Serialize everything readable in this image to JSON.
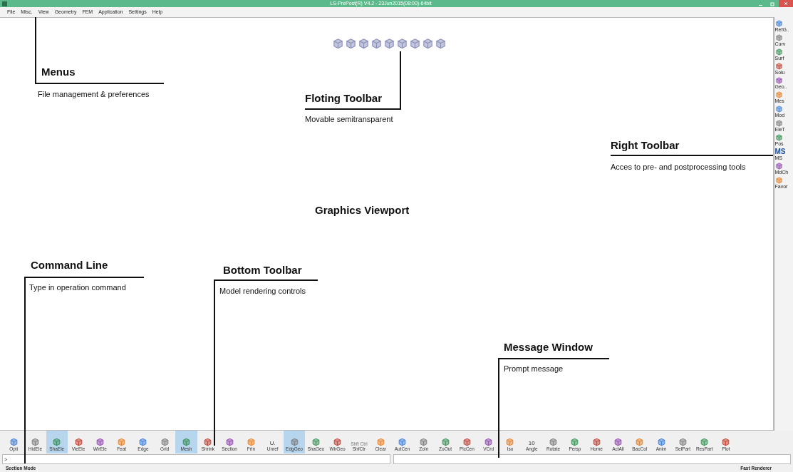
{
  "window": {
    "title": "LS-PrePost(R) V4.2 - 23Jun2015(08:00)-64bit"
  },
  "menu": [
    "File",
    "Misc.",
    "View",
    "Geometry",
    "FEM",
    "Application",
    "Settings",
    "Help"
  ],
  "annotations": [
    {
      "heading": "Menus",
      "text": "File management & preferences"
    },
    {
      "heading": "Floting Toolbar",
      "text": "Movable semitransparent"
    },
    {
      "heading": "Right Toolbar",
      "text": "Acces to pre- and postprocessing tools"
    },
    {
      "heading": "Graphics Viewport"
    },
    {
      "heading": "Command Line",
      "text": "Type in operation command"
    },
    {
      "heading": "Bottom Toolbar",
      "text": "Model rendering controls"
    },
    {
      "heading": "Message Window",
      "text": "Prompt message"
    }
  ],
  "right_toolbar": [
    {
      "label": "RefG.."
    },
    {
      "label": "Curv"
    },
    {
      "label": "Surf"
    },
    {
      "label": "Solu"
    },
    {
      "label": "Geo.."
    },
    {
      "label": "Mes"
    },
    {
      "label": "Mod"
    },
    {
      "label": "EleT"
    },
    {
      "label": "Pos"
    },
    {
      "label": "MS",
      "icon_text": "MS"
    },
    {
      "label": "MdCh"
    },
    {
      "label": "Favor"
    }
  ],
  "bottom_toolbar": [
    {
      "label": "Opti",
      "selected": false
    },
    {
      "label": "HidEle",
      "selected": false
    },
    {
      "label": "ShaEle",
      "selected": true
    },
    {
      "label": "VieEle",
      "selected": false
    },
    {
      "label": "WirEle",
      "selected": false
    },
    {
      "label": "Feat",
      "selected": false
    },
    {
      "label": "Edge",
      "selected": false
    },
    {
      "label": "Grid",
      "selected": false
    },
    {
      "label": "Mesh",
      "selected": true
    },
    {
      "label": "Shrink",
      "selected": false
    },
    {
      "label": "Section",
      "selected": false
    },
    {
      "label": "Frin",
      "selected": false
    },
    {
      "label": "Unref",
      "selected": false,
      "icon_text": "U."
    },
    {
      "label": "EdgGeo",
      "selected": true
    },
    {
      "label": "ShaGeo",
      "selected": false
    },
    {
      "label": "WirGeo",
      "selected": false
    },
    {
      "label": "ShfCtr",
      "selected": false,
      "icon_text": "Shft Ctrl"
    },
    {
      "label": "Clear",
      "selected": false
    },
    {
      "label": "AutCen",
      "selected": false
    },
    {
      "label": "ZoIn",
      "selected": false
    },
    {
      "label": "ZoOut",
      "selected": false
    },
    {
      "label": "PicCen",
      "selected": false
    },
    {
      "label": "VCrd",
      "selected": false
    },
    {
      "label": "Iso",
      "selected": false
    },
    {
      "label": "Angle",
      "selected": false,
      "icon_text": "10"
    },
    {
      "label": "Rotate",
      "selected": false
    },
    {
      "label": "Persp",
      "selected": false
    },
    {
      "label": "Home",
      "selected": false
    },
    {
      "label": "ActAll",
      "selected": false
    },
    {
      "label": "BacCol",
      "selected": false
    },
    {
      "label": "Anim",
      "selected": false
    },
    {
      "label": "SelPart",
      "selected": false
    },
    {
      "label": "ResPart",
      "selected": false
    },
    {
      "label": "Plot",
      "selected": false
    }
  ],
  "command_line": {
    "value": ">"
  },
  "status_bar": {
    "left": "Section Mode",
    "right": "Fast Renderer"
  }
}
